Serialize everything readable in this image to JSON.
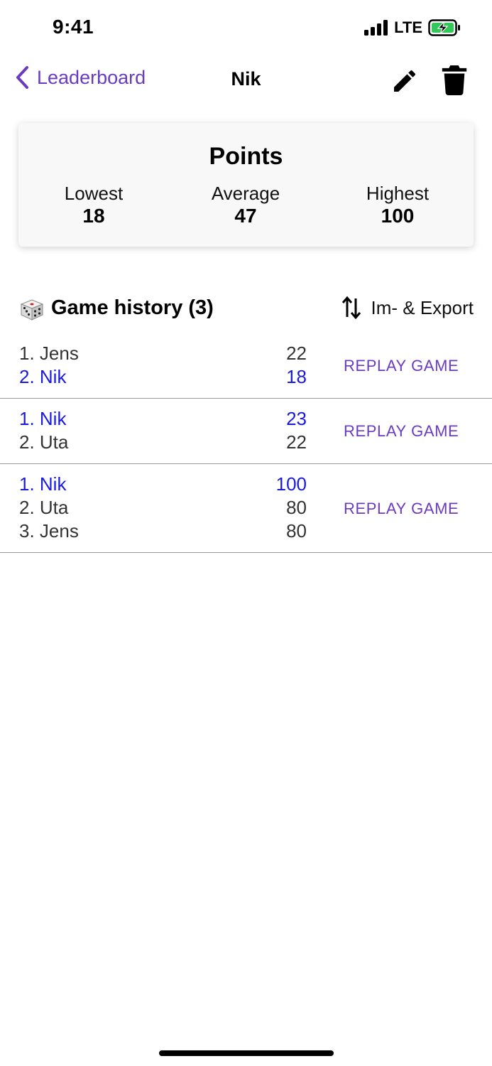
{
  "status_bar": {
    "time": "9:41",
    "network": "LTE"
  },
  "nav": {
    "back_label": "Leaderboard",
    "title": "Nik",
    "accent_color": "#6a3bbf"
  },
  "points": {
    "title": "Points",
    "lowest_label": "Lowest",
    "lowest_value": "18",
    "average_label": "Average",
    "average_value": "47",
    "highest_label": "Highest",
    "highest_value": "100"
  },
  "history": {
    "title": "Game history (3)",
    "export_label": "Im- & Export",
    "replay_label": "REPLAY GAME",
    "highlight_color": "#1a1adf",
    "games": [
      {
        "players": [
          {
            "rank_name": "1. Jens",
            "score": "22",
            "is_me": false
          },
          {
            "rank_name": "2. Nik",
            "score": "18",
            "is_me": true
          }
        ]
      },
      {
        "players": [
          {
            "rank_name": "1. Nik",
            "score": "23",
            "is_me": true
          },
          {
            "rank_name": "2. Uta",
            "score": "22",
            "is_me": false
          }
        ]
      },
      {
        "players": [
          {
            "rank_name": "1. Nik",
            "score": "100",
            "is_me": true
          },
          {
            "rank_name": "2. Uta",
            "score": "80",
            "is_me": false
          },
          {
            "rank_name": "3. Jens",
            "score": "80",
            "is_me": false
          }
        ]
      }
    ]
  }
}
